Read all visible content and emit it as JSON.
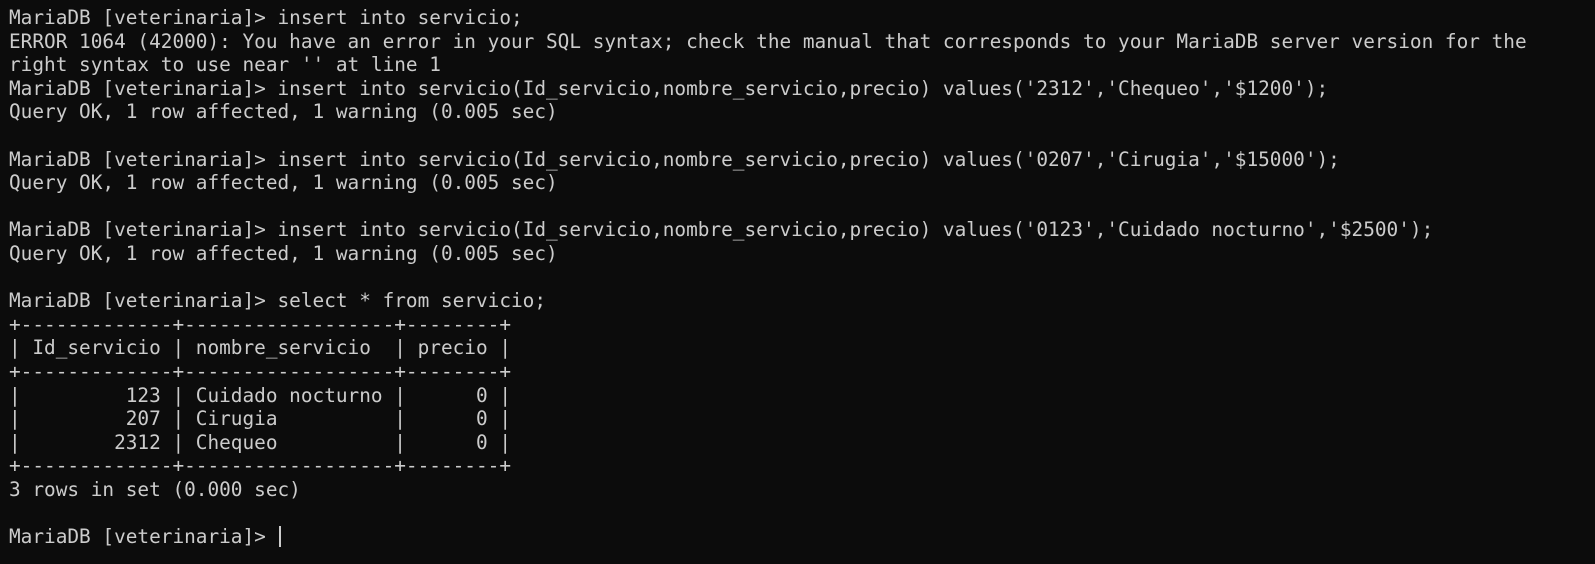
{
  "terminal": {
    "lines": [
      "MariaDB [veterinaria]> insert into servicio;",
      "ERROR 1064 (42000): You have an error in your SQL syntax; check the manual that corresponds to your MariaDB server version for the right syntax to use near '' at line 1",
      "MariaDB [veterinaria]> insert into servicio(Id_servicio,nombre_servicio,precio) values('2312','Chequeo','$1200');",
      "Query OK, 1 row affected, 1 warning (0.005 sec)",
      "",
      "MariaDB [veterinaria]> insert into servicio(Id_servicio,nombre_servicio,precio) values('0207','Cirugia','$15000');",
      "Query OK, 1 row affected, 1 warning (0.005 sec)",
      "",
      "MariaDB [veterinaria]> insert into servicio(Id_servicio,nombre_servicio,precio) values('0123','Cuidado nocturno','$2500');",
      "Query OK, 1 row affected, 1 warning (0.005 sec)",
      "",
      "MariaDB [veterinaria]> select * from servicio;",
      "+-------------+------------------+--------+",
      "| Id_servicio | nombre_servicio  | precio |",
      "+-------------+------------------+--------+",
      "|         123 | Cuidado nocturno |      0 |",
      "|         207 | Cirugia          |      0 |",
      "|        2312 | Chequeo          |      0 |",
      "+-------------+------------------+--------+",
      "3 rows in set (0.000 sec)",
      "",
      "MariaDB [veterinaria]> "
    ]
  },
  "colors": {
    "background": "#0c0c0c",
    "foreground": "#cccccc"
  }
}
